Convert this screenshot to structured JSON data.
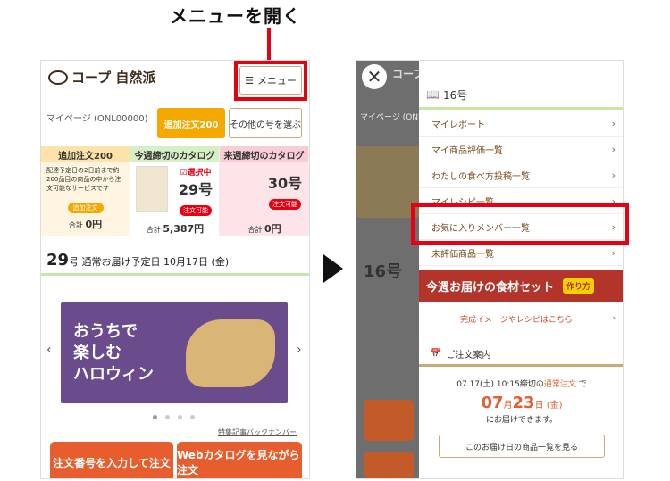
{
  "header_title": "メニューを開く",
  "left": {
    "logo": "コープ 自然派",
    "menu_label": "メニュー",
    "mypage": "マイページ (ONL00000)",
    "add_order_btn": "追加注文200",
    "other_issue_btn": "その他の号を選ぶ",
    "cols": [
      {
        "title": "追加注文200",
        "desc": "配達予定日の2日前まで約200品目の商品の中から注文可能なサービスです",
        "badge": "追加注文",
        "total_label": "合計",
        "total": "0円"
      },
      {
        "title": "今週締切のカタログ",
        "status": "選択中",
        "issue": "29号",
        "badge": "注文可能",
        "total_label": "合計",
        "total": "5,387円"
      },
      {
        "title": "来週締切のカタログ",
        "issue": "30号",
        "badge": "注文可能",
        "total_label": "合計",
        "total": "0円"
      }
    ],
    "delivery_no": "29",
    "delivery_text": "号 通常お届け予定日 10月17日 (金)",
    "banner_text": [
      "おうちで",
      "楽しむ",
      "ハロウィン"
    ],
    "backnumber": "特集記事バックナンバー",
    "btn_order_no": "注文番号を入力して注文",
    "btn_web_catalog": "Webカタログを見ながら注文"
  },
  "right": {
    "issue_label": "16号",
    "menu_items": [
      "マイレポート",
      "マイ商品評価一覧",
      "わたしの食べ方投稿一覧",
      "マイレシピ一覧",
      "お気に入りメンバー一覧",
      "未評価商品一覧"
    ],
    "shokuzai_title": "今週お届けの食材セット",
    "shokuzai_howto": "作り方",
    "kansei_link": "完成イメージやレシピはこちら",
    "order_info_title": "ご注文案内",
    "order_line1_pre": "07.17(土) 10:15締切の",
    "order_line1_red": "通常注文",
    "order_line1_post": "で",
    "order_month": "07",
    "order_day": "23",
    "order_mid": "月",
    "order_suffix": "日 (金)",
    "order_line3": "にお届けできます。",
    "order_btn": "このお届け日の商品一覧を見る",
    "bg_top": "コープ",
    "bg_mypage": "マイページ (ONL0",
    "bg_issue": "16号"
  },
  "colors": {
    "accent_red": "#e60012",
    "orange": "#f5a800",
    "brand_orange": "#e85d2e"
  }
}
